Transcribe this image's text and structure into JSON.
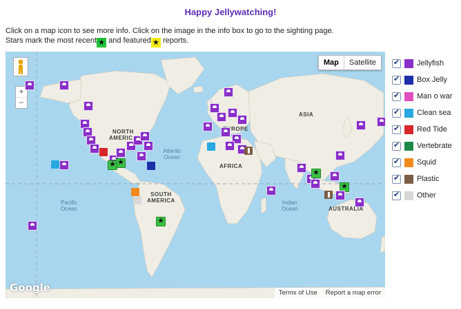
{
  "page_title": "Happy Jellywatching!",
  "intro": {
    "line1": "Click on a map icon to see more info. Click on the image in the info box to go to the sighting page.",
    "line2_a": "Stars mark the most recent",
    "line2_b": " and featured",
    "line2_c": " reports."
  },
  "map_type": {
    "map": "Map",
    "satellite": "Satellite",
    "selected": "Map"
  },
  "zoom": {
    "in": "+",
    "out": "−"
  },
  "labels": {
    "north_america": "NORTH\nAMERICA",
    "south_america": "SOUTH\nAMERICA",
    "europe": "EUROPE",
    "asia": "ASIA",
    "africa": "AFRICA",
    "australia": "AUSTRALIA",
    "atlantic": "Atlantic\nOcean",
    "pacific": "Pacific\nOcean",
    "indian": "Indian\nOcean"
  },
  "google_logo": "Google",
  "footer": {
    "terms": "Terms of Use",
    "report": "Report a map error"
  },
  "legend": [
    {
      "label": "Jellyfish",
      "checked": true,
      "color": "#8a2ec8",
      "icon": "jellyfish-icon"
    },
    {
      "label": "Box Jelly",
      "checked": true,
      "color": "#1c2ea8",
      "icon": "box-jelly-icon"
    },
    {
      "label": "Man o war",
      "checked": true,
      "color": "#e24fbf",
      "icon": "man-o-war-icon"
    },
    {
      "label": "Clean sea",
      "checked": true,
      "color": "#27a8e0",
      "icon": "clean-sea-icon"
    },
    {
      "label": "Red Tide",
      "checked": true,
      "color": "#d7262c",
      "icon": "red-tide-icon"
    },
    {
      "label": "Vertebrate",
      "checked": true,
      "color": "#1e8a4a",
      "icon": "vertebrate-icon"
    },
    {
      "label": "Squid",
      "checked": true,
      "color": "#f28a1e",
      "icon": "squid-icon"
    },
    {
      "label": "Plastic",
      "checked": true,
      "color": "#7c5e46",
      "icon": "plastic-icon"
    },
    {
      "label": "Other",
      "checked": true,
      "color": "#d8d8d8",
      "icon": "other-icon"
    }
  ]
}
